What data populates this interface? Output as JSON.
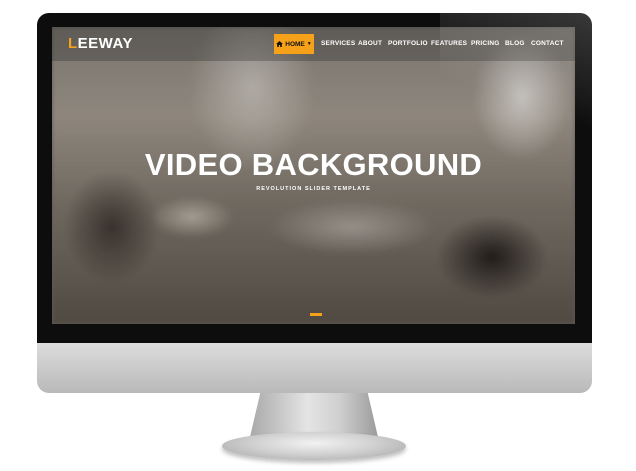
{
  "site": {
    "logo_initial": "L",
    "logo_rest": "EEWAY"
  },
  "nav": {
    "home_label": "HOME",
    "items": [
      "SERVICES",
      "ABOUT",
      "PORTFOLIO",
      "FEATURES",
      "PRICING",
      "BLOG",
      "CONTACT"
    ]
  },
  "hero": {
    "title": "VIDEO BACKGROUND",
    "subtitle": "REVOLUTION SLIDER TEMPLATE"
  },
  "icons": {
    "home": "home-icon",
    "caret": "chevron-down-icon"
  },
  "colors": {
    "accent": "#f5a11a",
    "text": "#ffffff"
  }
}
